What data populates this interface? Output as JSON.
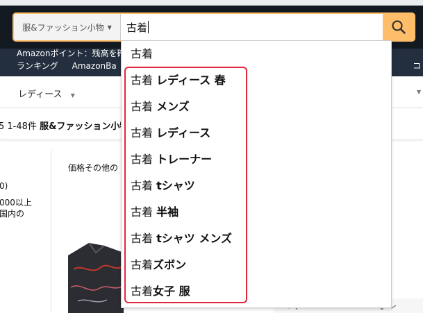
{
  "search": {
    "category_label": "服&ファッション小物",
    "query": "古着"
  },
  "nav": {
    "points_text": "Amazonポイント：残高を確",
    "links": [
      "ランキング",
      "AmazonBa"
    ],
    "right_fragment": "コ"
  },
  "subnav": {
    "item_label": "レディース"
  },
  "results": {
    "count_text": "5 1-48件",
    "category_text": "服&ファッション小物"
  },
  "filters": {
    "lines": [
      "0)",
      "000以上",
      "国内の"
    ]
  },
  "main": {
    "price_note": "価格その他の"
  },
  "suggestions": [
    {
      "base": "古着",
      "bold": ""
    },
    {
      "base": "古着 ",
      "bold": "レディース 春"
    },
    {
      "base": "古着 ",
      "bold": "メンズ"
    },
    {
      "base": "古着 ",
      "bold": "レディース"
    },
    {
      "base": "古着 ",
      "bold": "トレーナー"
    },
    {
      "base": "古着 ",
      "bold": "tシャツ"
    },
    {
      "base": "古着 ",
      "bold": "半袖"
    },
    {
      "base": "古着 ",
      "bold": "tシャツ メンズ"
    },
    {
      "base": "古着",
      "bold": "ズボン"
    },
    {
      "base": "古着",
      "bold": "女子 服"
    }
  ],
  "icons": {
    "search_button": "search-icon",
    "category_caret": "caret-down-icon"
  },
  "colors": {
    "header_bg": "#131921",
    "subheader_bg": "#232f3e",
    "search_accent": "#febd69",
    "highlight_border": "#e0283d"
  }
}
